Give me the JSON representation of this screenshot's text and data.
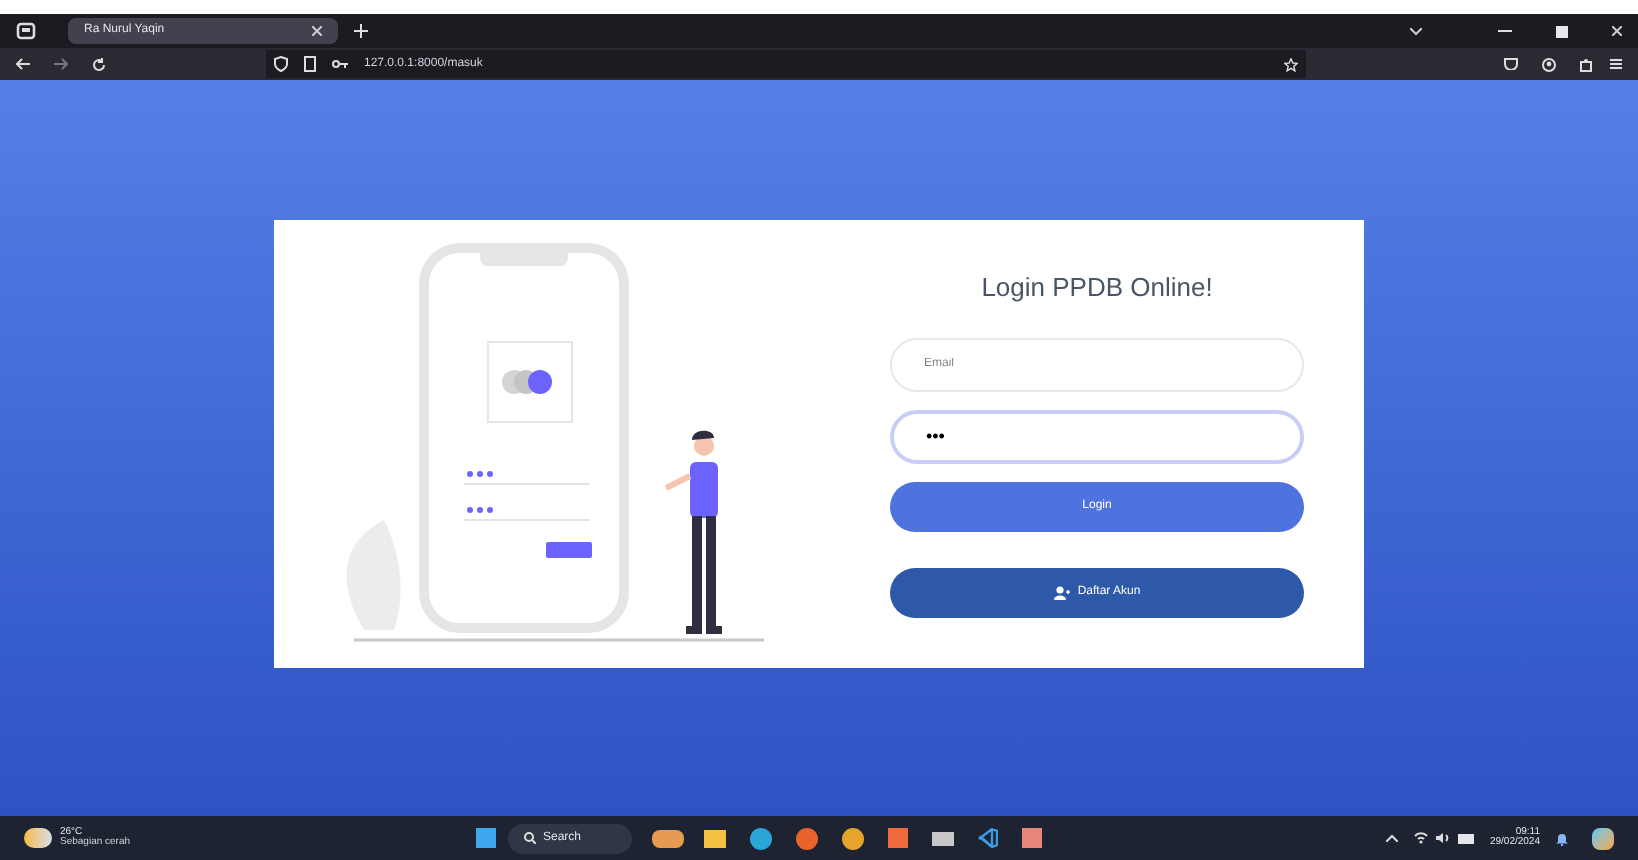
{
  "browser": {
    "tab": {
      "title": "Ra Nurul Yaqin",
      "selected": true
    },
    "url": "127.0.0.1:8000/masuk"
  },
  "login": {
    "title": "Login PPDB Online!",
    "email": {
      "placeholder": "Email"
    },
    "password": {
      "value": "•••",
      "focused": true
    },
    "login_button": "Login",
    "register_button": "Daftar Akun"
  },
  "taskbar": {
    "temperature": "26°C",
    "weather": "Sebagian cerah",
    "search": "Search",
    "time": "09:11",
    "date": "29/02/2024"
  }
}
